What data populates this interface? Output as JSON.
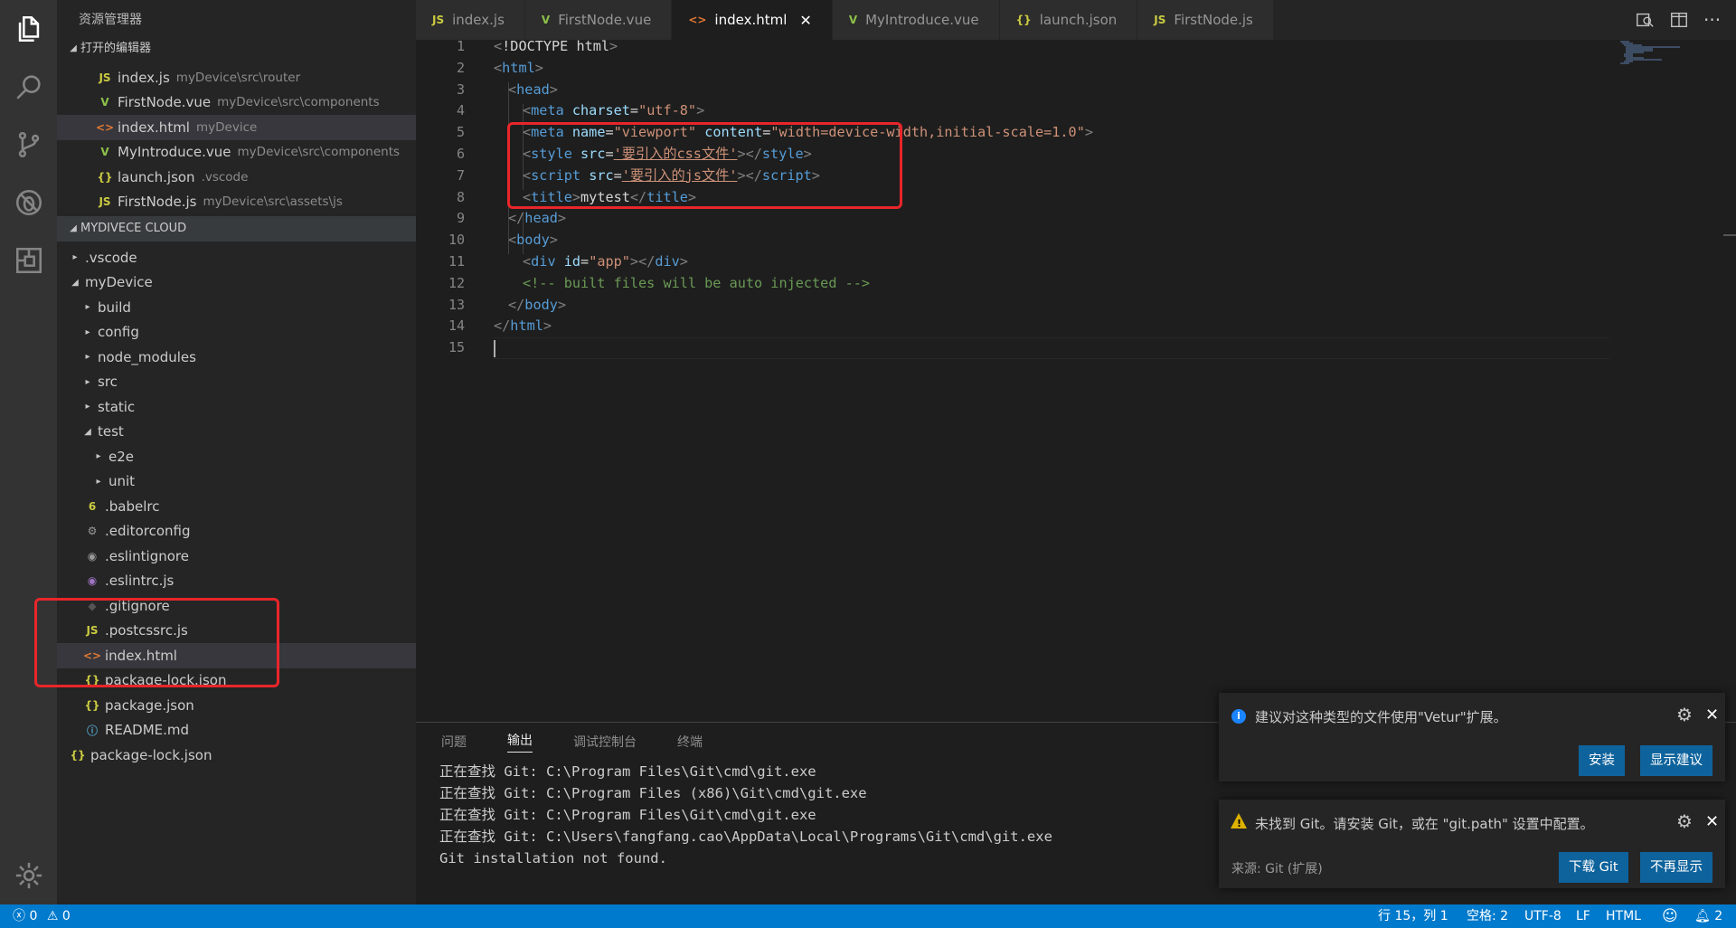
{
  "sidebar": {
    "title": "资源管理器",
    "open_editors_title": "打开的编辑器",
    "project_title": "MYDIVECE CLOUD"
  },
  "open_editors": [
    {
      "name": "index.js",
      "desc": "myDevice\\src\\router",
      "icon": "JS"
    },
    {
      "name": "FirstNode.vue",
      "desc": "myDevice\\src\\components",
      "icon": "V"
    },
    {
      "name": "index.html",
      "desc": "myDevice",
      "icon": "<>"
    },
    {
      "name": "MyIntroduce.vue",
      "desc": "myDevice\\src\\components",
      "icon": "V"
    },
    {
      "name": "launch.json",
      "desc": ".vscode",
      "icon": "{}"
    },
    {
      "name": "FirstNode.js",
      "desc": "myDevice\\src\\assets\\js",
      "icon": "JS"
    }
  ],
  "tree": [
    ".vscode",
    "myDevice",
    "build",
    "config",
    "node_modules",
    "src",
    "static",
    "test",
    "e2e",
    "unit",
    ".babelrc",
    ".editorconfig",
    ".eslintignore",
    ".eslintrc.js",
    ".gitignore",
    ".postcssrc.js",
    "index.html",
    "package-lock.json",
    "package.json",
    "README.md",
    "package-lock.json"
  ],
  "tabs": [
    {
      "label": "index.js",
      "icon": "JS"
    },
    {
      "label": "FirstNode.vue",
      "icon": "V"
    },
    {
      "label": "index.html",
      "icon": "<>",
      "close": "✕"
    },
    {
      "label": "MyIntroduce.vue",
      "icon": "V"
    },
    {
      "label": "launch.json",
      "icon": "{}"
    },
    {
      "label": "FirstNode.js",
      "icon": "JS"
    }
  ],
  "code_lines": [
    "1",
    "2",
    "3",
    "4",
    "5",
    "6",
    "7",
    "8",
    "9",
    "10",
    "11",
    "12",
    "13",
    "14",
    "15"
  ],
  "code": {
    "l1_a": "<",
    "l1_b": "!DOCTYPE html",
    "l1_c": ">",
    "t_html": "html",
    "t_head": "head",
    "t_meta": "meta",
    "t_style": "style",
    "t_script": "script",
    "t_title": "title",
    "t_body": "body",
    "t_div": "div",
    "a_charset": "charset",
    "a_name": "name",
    "a_content": "content",
    "a_src": "src",
    "a_id": "id",
    "v_utf8": "\"utf-8\"",
    "v_viewport": "\"viewport\"",
    "v_content": "\"width=device-width,initial-scale=1.0\"",
    "v_css": "'要引入的css文件'",
    "v_js": "'要引入的js文件'",
    "v_app": "\"app\"",
    "title_text": "mytest",
    "comment": "<!-- built files will be auto injected -->"
  },
  "panel": {
    "tabs": [
      "问题",
      "输出",
      "调试控制台",
      "终端"
    ],
    "output": [
      "正在查找 Git: C:\\Program Files\\Git\\cmd\\git.exe",
      "正在查找 Git: C:\\Program Files (x86)\\Git\\cmd\\git.exe",
      "正在查找 Git: C:\\Program Files\\Git\\cmd\\git.exe",
      "正在查找 Git: C:\\Users\\fangfang.cao\\AppData\\Local\\Programs\\Git\\cmd\\git.exe",
      "Git installation not found."
    ]
  },
  "notifications": {
    "vetur": {
      "message": "建议对这种类型的文件使用\"Vetur\"扩展。",
      "install": "安装",
      "show": "显示建议"
    },
    "git": {
      "message": "未找到 Git。请安装 Git，或在 \"git.path\" 设置中配置。",
      "source": "来源: Git (扩展)",
      "download": "下载 Git",
      "dismiss": "不再显示"
    }
  },
  "status": {
    "errors": "0",
    "warnings": "0",
    "position": "行 15，列 1",
    "spaces": "空格: 2",
    "encoding": "UTF-8",
    "eol": "LF",
    "language": "HTML",
    "notifications": "2"
  },
  "colors": {
    "accent": "#007acc",
    "highlight": "#e8262a"
  }
}
